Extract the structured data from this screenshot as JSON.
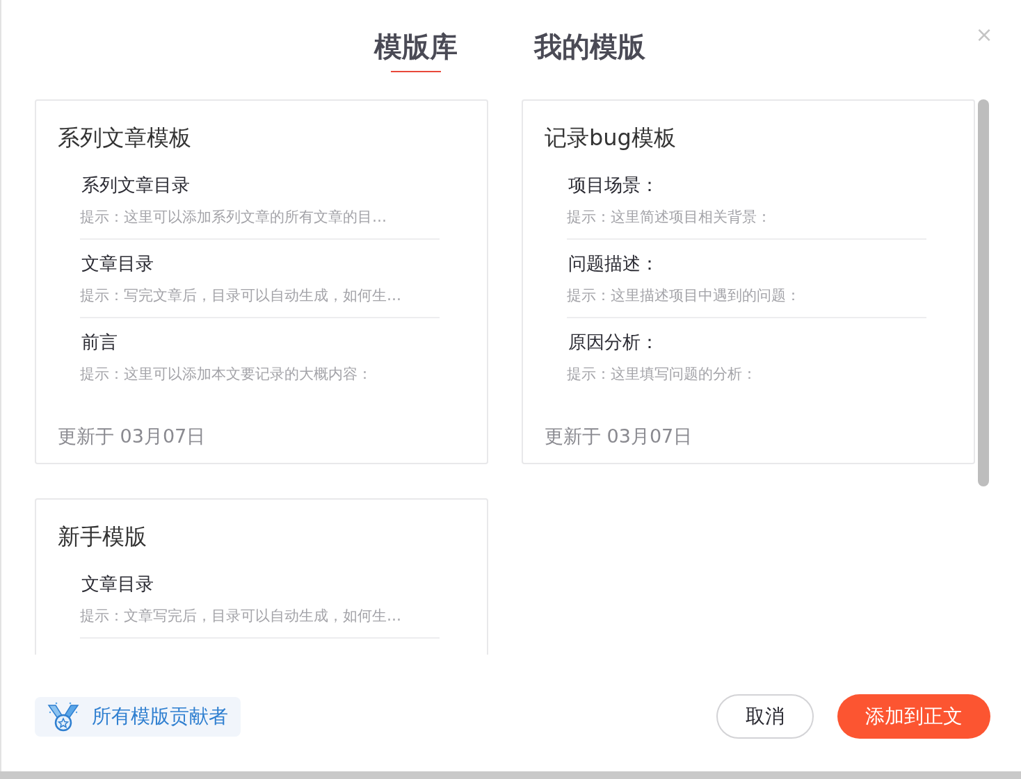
{
  "tabs": [
    {
      "label": "模版库",
      "selected": true
    },
    {
      "label": "我的模版",
      "selected": false
    }
  ],
  "close": "×",
  "templates": [
    {
      "title": "系列文章模板",
      "sections": [
        {
          "heading": "系列文章目录",
          "hint": "提示：这里可以添加系列文章的所有文章的目…"
        },
        {
          "heading": "文章目录",
          "hint": "提示：写完文章后，目录可以自动生成，如何生…"
        },
        {
          "heading": "前言",
          "hint": "提示：这里可以添加本文要记录的大概内容："
        }
      ],
      "updated": "更新于 03月07日"
    },
    {
      "title": "记录bug模板",
      "sections": [
        {
          "heading": "项目场景：",
          "hint": "提示：这里简述项目相关背景："
        },
        {
          "heading": "问题描述：",
          "hint": "提示：这里描述项目中遇到的问题："
        },
        {
          "heading": "原因分析：",
          "hint": "提示：这里填写问题的分析："
        }
      ],
      "updated": "更新于 03月07日"
    },
    {
      "title": "新手模版",
      "sections": [
        {
          "heading": "文章目录",
          "hint": "提示：文章写完后，目录可以自动生成，如何生…"
        }
      ]
    }
  ],
  "contributors_link": "所有模版贡献者",
  "buttons": [
    {
      "label": "取消",
      "kind": "secondary"
    },
    {
      "label": "添加到正文",
      "kind": "primary"
    }
  ]
}
